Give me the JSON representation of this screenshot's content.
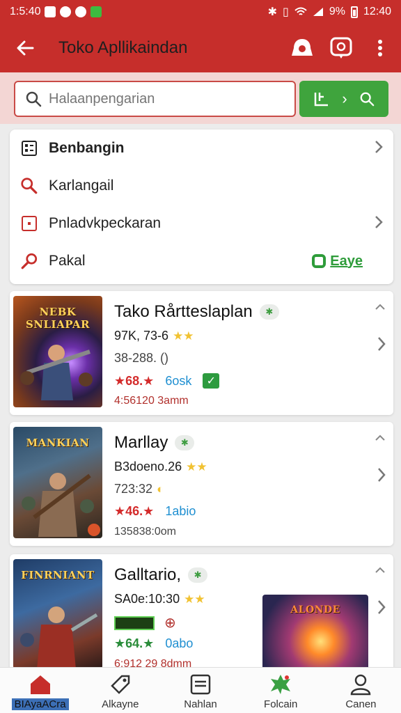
{
  "status_bar": {
    "time_left": "1:5:40",
    "battery": "9%",
    "time_right": "12:40"
  },
  "app_bar": {
    "title": "Toko Apllikaindan"
  },
  "search": {
    "placeholder": "Halaanpengarian"
  },
  "menu": {
    "items": [
      {
        "label": "Benbangin"
      },
      {
        "label": "Karlangail"
      },
      {
        "label": "Pnladvkpeckaran"
      },
      {
        "label": "Pakal"
      }
    ],
    "easy_label": "Eaye"
  },
  "games": [
    {
      "thumb_text": "NEBK SNLIAPAR",
      "title": "Tako Rårtteslaplan",
      "size": "97K, 73-6",
      "meta": "38-288. ()",
      "rating": "68.",
      "tag": "6osk",
      "date": "4:56120 3amm"
    },
    {
      "thumb_text": "MANKIAN",
      "title": "Marllay",
      "size": "B3doeno.26",
      "meta": "723:32",
      "rating": "46.",
      "tag": "1abio",
      "date": "135838:0om"
    },
    {
      "thumb_text": "FINRNIANT",
      "title": "Galltario,",
      "size": "SA0e:10:30",
      "meta": "",
      "rating": "64.",
      "tag": "0abo",
      "date": "6:912 29 8dmm",
      "banner_text": "ALONDE"
    }
  ],
  "bottom_nav": [
    {
      "label": "BIAyaACra",
      "icon": "home-icon"
    },
    {
      "label": "Alkayne",
      "icon": "tag-icon"
    },
    {
      "label": "Nahlan",
      "icon": "list-icon"
    },
    {
      "label": "Folcain",
      "icon": "leaf-icon"
    },
    {
      "label": "Canen",
      "icon": "person-icon"
    }
  ],
  "colors": {
    "primary": "#c62e2b",
    "accent_green": "#3fa43d",
    "surface": "#ffffff"
  }
}
